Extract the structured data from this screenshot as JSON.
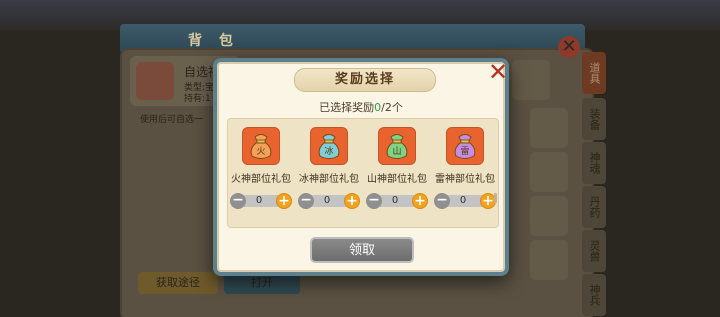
{
  "background": {
    "panel_title": "背 包",
    "item_name": "自选神",
    "item_type": "类型:宝",
    "item_owned": "持有:1",
    "item_desc": "使用后可自选一",
    "source_button": "获取途径",
    "open_button": "打开",
    "side_tabs": [
      "道具",
      "装备",
      "神魂",
      "丹药",
      "灵兽",
      "神兵"
    ]
  },
  "modal": {
    "title": "奖励选择",
    "selected_prefix": "已选择奖励",
    "selected_count": "0",
    "selected_suffix": "/2个",
    "claim_button": "领取",
    "rewards": [
      {
        "name": "火神部位礼包",
        "value": "0",
        "color": "#f4a25a",
        "glyph": "火"
      },
      {
        "name": "冰神部位礼包",
        "value": "0",
        "color": "#7fd0d6",
        "glyph": "冰"
      },
      {
        "name": "山神部位礼包",
        "value": "0",
        "color": "#7fd483",
        "glyph": "山"
      },
      {
        "name": "雷神部位礼包",
        "value": "0",
        "color": "#c58ee0",
        "glyph": "雷"
      }
    ]
  },
  "colors": {
    "accent_orange": "#f2a21e",
    "close_red": "#b4321d",
    "count_green": "#2ea33c"
  },
  "icons": {
    "close": "close-icon",
    "minus": "minus-icon",
    "plus": "plus-icon",
    "gift_bag": "gift-bag-icon"
  }
}
